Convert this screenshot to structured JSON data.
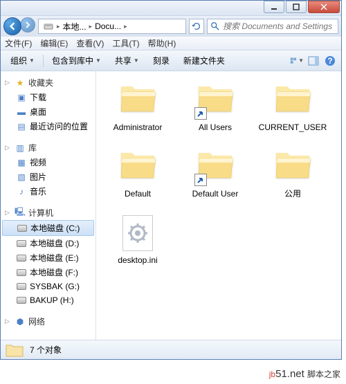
{
  "breadcrumb": {
    "drive": "本地...",
    "folder": "Docu..."
  },
  "search": {
    "placeholder": "搜索 Documents and Settings"
  },
  "menu": {
    "file": "文件(F)",
    "edit": "编辑(E)",
    "view": "查看(V)",
    "tools": "工具(T)",
    "help": "帮助(H)"
  },
  "toolbar": {
    "organize": "组织",
    "include": "包含到库中",
    "share": "共享",
    "burn": "刻录",
    "newfolder": "新建文件夹"
  },
  "nav": {
    "favorites": {
      "title": "收藏夹",
      "items": [
        "下载",
        "桌面",
        "最近访问的位置"
      ]
    },
    "libraries": {
      "title": "库",
      "items": [
        "视频",
        "图片",
        "音乐"
      ]
    },
    "computer": {
      "title": "计算机",
      "items": [
        "本地磁盘 (C:)",
        "本地磁盘 (D:)",
        "本地磁盘 (E:)",
        "本地磁盘 (F:)",
        "SYSBAK (G:)",
        "BAKUP (H:)"
      ]
    },
    "network": {
      "title": "网络"
    }
  },
  "files": [
    {
      "name": "Administrator",
      "type": "folder",
      "shortcut": false
    },
    {
      "name": "All Users",
      "type": "folder",
      "shortcut": true
    },
    {
      "name": "CURRENT_USER",
      "type": "folder",
      "shortcut": false
    },
    {
      "name": "Default",
      "type": "folder",
      "shortcut": false
    },
    {
      "name": "Default User",
      "type": "folder",
      "shortcut": true
    },
    {
      "name": "公用",
      "type": "folder",
      "shortcut": false
    },
    {
      "name": "desktop.ini",
      "type": "ini",
      "shortcut": false
    }
  ],
  "status": {
    "count": "7 个对象"
  },
  "watermark": "脚本之家"
}
